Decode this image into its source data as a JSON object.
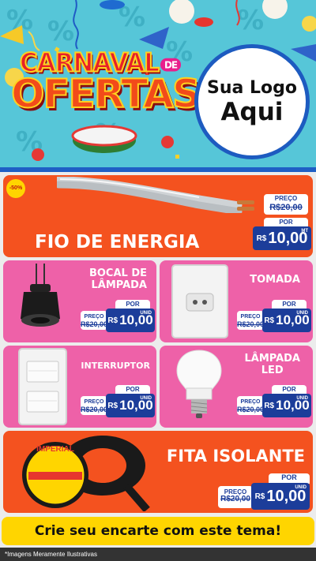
{
  "header": {
    "headline_line1": "CARNAVAL",
    "headline_de": "DE",
    "headline_line2": "OFERTAS",
    "logo_line1": "Sua Logo",
    "logo_line2": "Aqui"
  },
  "colors": {
    "orange_card": "#f4521f",
    "pink_card": "#ee61a8",
    "price_blue": "#1c3d9a",
    "banner_yellow": "#ffd500",
    "header_bg": "#56c6d8"
  },
  "products": [
    {
      "name": "FIO DE ENERGIA",
      "badge": "-50%",
      "preco_label": "PREÇO",
      "old_price": "R$20,00",
      "por_label": "POR",
      "currency": "R$",
      "price": "10,00",
      "unit": "MT",
      "icon": "cable-icon"
    },
    {
      "name_line1": "BOCAL DE",
      "name_line2": "LÂMPADA",
      "preco_label": "PREÇO",
      "old_price": "R$20,00",
      "por_label": "POR",
      "currency": "R$",
      "price": "10,00",
      "unit": "UNID",
      "icon": "lamp-socket-icon"
    },
    {
      "name": "TOMADA",
      "preco_label": "PREÇO",
      "old_price": "R$20,00",
      "por_label": "POR",
      "currency": "R$",
      "price": "10,00",
      "unit": "UNID",
      "icon": "outlet-icon"
    },
    {
      "name": "INTERRUPTOR",
      "preco_label": "PREÇO",
      "old_price": "R$20,00",
      "por_label": "POR",
      "currency": "R$",
      "price": "10,00",
      "unit": "UNID",
      "icon": "switch-icon"
    },
    {
      "name_line1": "LÂMPADA",
      "name_line2": "LED",
      "preco_label": "PREÇO",
      "old_price": "R$20,00",
      "por_label": "POR",
      "currency": "R$",
      "price": "10,00",
      "unit": "UNID",
      "icon": "led-bulb-icon"
    },
    {
      "name": "FITA ISOLANTE",
      "brand": "IMPERIAL",
      "preco_label": "PREÇO",
      "old_price": "R$20,00",
      "por_label": "POR",
      "currency": "R$",
      "price": "10,00",
      "unit": "UNID",
      "icon": "insulating-tape-icon"
    }
  ],
  "cta": "Crie seu encarte com este tema!",
  "disclaimer": "*Imagens Meramente Ilustrativas"
}
